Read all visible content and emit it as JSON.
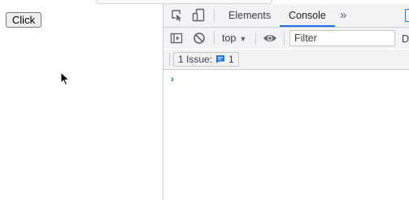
{
  "page": {
    "button_label": "Click"
  },
  "devtools": {
    "tabs": [
      {
        "label": "Elements",
        "active": false
      },
      {
        "label": "Console",
        "active": true
      }
    ],
    "more_tabs_glyph": "»",
    "toolbar": {
      "context_label": "top",
      "context_caret": "▼",
      "filter_placeholder": "Filter",
      "clipped_label": "D"
    },
    "issues": {
      "label": "1 Issue:",
      "count": "1"
    },
    "console": {
      "prompt": "›"
    },
    "colors": {
      "accent": "#1a73e8",
      "toolbar_bg": "#f1f3f4",
      "border": "#cbcdd1"
    },
    "icons": [
      "inspect-element-icon",
      "device-toggle-icon",
      "sidebar-toggle-icon",
      "clear-console-icon",
      "eye-icon",
      "issue-message-icon",
      "cursor-pointer-icon"
    ]
  }
}
